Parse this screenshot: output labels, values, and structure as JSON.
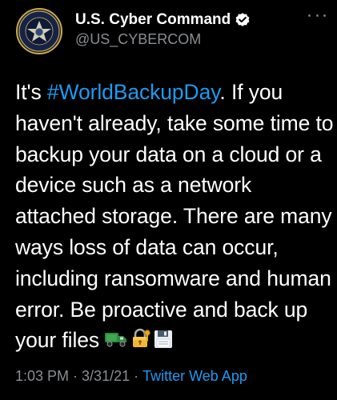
{
  "header": {
    "display_name": "U.S. Cyber Command",
    "handle": "@US_CYBERCOM",
    "verified": true,
    "avatar_icon": "us-cyber-command-seal-icon",
    "more_icon": "ellipsis-icon"
  },
  "tweet": {
    "lines": [
      {
        "before": "It's ",
        "hashtag": "#WorldBackupDay",
        "after": ". If you"
      },
      {
        "text": "haven't already, take some time to"
      },
      {
        "text": "backup your data on a cloud or a"
      },
      {
        "text": "device such as a network"
      },
      {
        "text": "attached storage. There are many"
      },
      {
        "text": "ways loss of data can occur,"
      },
      {
        "text": "including ransomware and human"
      },
      {
        "text": "error. Be proactive and back up"
      },
      {
        "text": "your files"
      }
    ],
    "emojis": [
      "delivery-truck-icon",
      "locked-with-key-icon",
      "floppy-disk-icon"
    ]
  },
  "meta": {
    "time": "1:03 PM",
    "date": "3/31/21",
    "separator": "·",
    "source": "Twitter Web App"
  },
  "colors": {
    "background": "#000000",
    "text": "#ffffff",
    "muted": "#8a8d91",
    "link": "#1d9bf0"
  }
}
